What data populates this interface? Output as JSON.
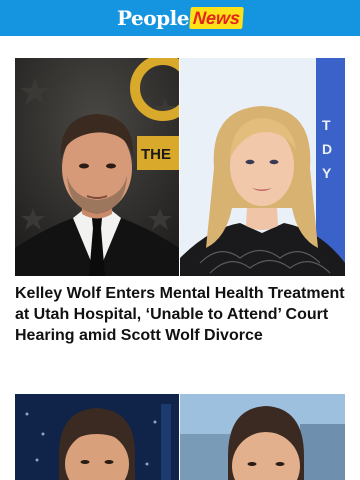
{
  "header": {
    "logo_people": "People",
    "logo_news": "News"
  },
  "story1": {
    "image_left_sign": "THE",
    "headline": "Kelley Wolf Enters Mental Health Treatment at Utah Hospital, ‘Unable to Attend’ Court Hearing amid Scott Wolf Divorce"
  },
  "colors": {
    "header_bg": "#1595e0",
    "news_badge_bg": "#ffe11a",
    "news_badge_text": "#e1261c",
    "headline_text": "#111111"
  }
}
